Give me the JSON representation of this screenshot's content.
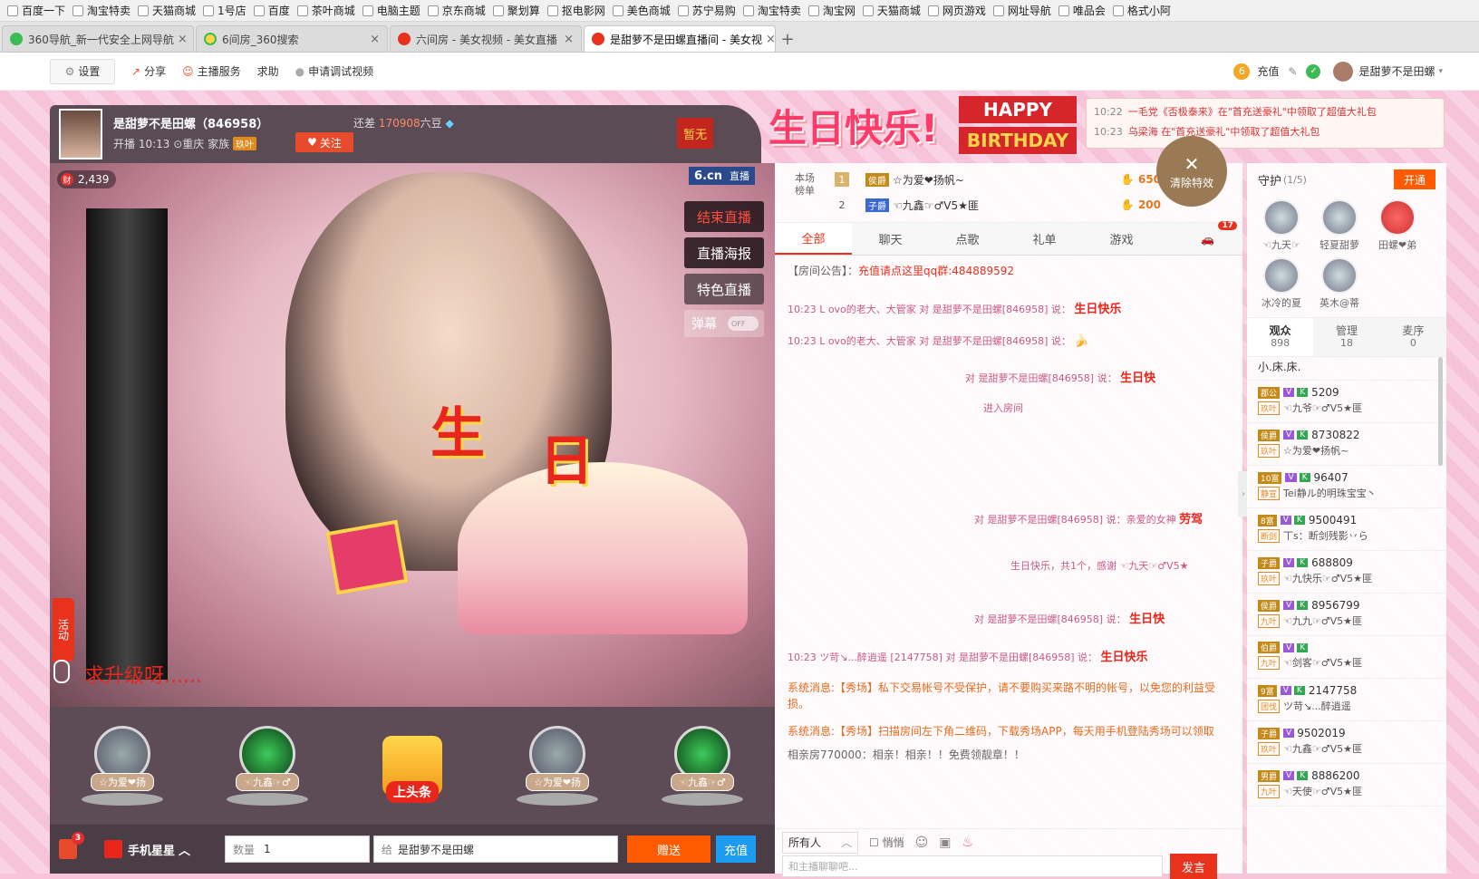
{
  "bookmarks": [
    "百度一下",
    "淘宝特卖",
    "天猫商城",
    "1号店",
    "百度",
    "茶叶商城",
    "电脑主题",
    "京东商城",
    "聚划算",
    "抠电影网",
    "美色商城",
    "苏宁易购",
    "淘宝特卖",
    "淘宝网",
    "天猫商城",
    "网页游戏",
    "网址导航",
    "唯品会",
    "格式小阿"
  ],
  "tabs": [
    {
      "label": "360导航_新一代安全上网导航",
      "close": "×"
    },
    {
      "label": "6间房_360搜索",
      "close": "×"
    },
    {
      "label": "六间房 - 美女视频 - 美女直播",
      "close": "×"
    },
    {
      "label": "是甜萝不是田螺直播间 - 美女视",
      "close": "×"
    }
  ],
  "tab_add": "+",
  "site_top": {
    "settings": "设置",
    "share": "分享",
    "host_service": "主播服务",
    "help": "求助",
    "apply_video": "申请调试视频",
    "recharge": "充值",
    "username": "是甜萝不是田螺"
  },
  "anchor": {
    "name": "是甜萝不是田螺（846958）",
    "need_prefix": "还差",
    "need_value": "170908",
    "need_unit": "六豆",
    "live_time": "开播 10:13",
    "city": "重庆",
    "family_label": "家族",
    "family_badge": "玖叶",
    "follow": "关注",
    "flag": "暂无"
  },
  "video": {
    "viewer_count": "2,439",
    "viewer_badge": "财",
    "logo": "6.cn",
    "logo_sub": "直播",
    "end_live": "结束直播",
    "live_poster": "直播海报",
    "special_live": "特色直播",
    "danmu": "弹幕",
    "danmu_switch": "OFF",
    "activity": "活动",
    "upgrade_text": "求升级呀......",
    "sheng": "生",
    "ri": "日"
  },
  "rank_items": [
    {
      "label": "☆为爱❤扬"
    },
    {
      "label": "☜九鑫☞♂"
    },
    {
      "label": "上头条"
    },
    {
      "label": "☆为爱❤扬"
    },
    {
      "label": "☜九鑫☞♂"
    }
  ],
  "gift_bar": {
    "badge": "3",
    "mobile_star": "手机星星",
    "qty_label": "数量",
    "qty_value": "1",
    "to_label": "给",
    "to_value": "是甜萝不是田螺",
    "send": "赠送",
    "charge": "充值"
  },
  "birthday": {
    "cn": "生日快乐!",
    "happy": "HAPPY",
    "birthday": "BIRTHDAY"
  },
  "notices": [
    {
      "time": "10:22",
      "text": "一毛党《否极泰来》在\"首充送豪礼\"中领取了超值大礼包"
    },
    {
      "time": "10:23",
      "text": "乌梁海 在\"首充送豪礼\"中领取了超值大礼包"
    }
  ],
  "clear_fx": "清除特效",
  "board": {
    "label": "本场榜单",
    "rows": [
      {
        "no": "1",
        "badge": "侯爵",
        "name": "☆为爱❤扬帆~",
        "score": "650"
      },
      {
        "no": "2",
        "badge": "子爵",
        "name": "☜九鑫☞♂V5★匪",
        "score": "200"
      }
    ]
  },
  "chat_tabs": [
    "全部",
    "聊天",
    "点歌",
    "礼单",
    "游戏"
  ],
  "car_badge": "17",
  "announcement": {
    "label": "【房间公告】：",
    "text": "充值请点这里qq群:484889592"
  },
  "messages": [
    {
      "text": "10:23 L ovo的老大、大管家 对 是甜萝不是田螺[846958] 说：",
      "em": "生日快乐"
    },
    {
      "text": "10:23 L ovo的老大、大管家 对 是甜萝不是田螺[846958] 说：",
      "em": "🍌"
    },
    {
      "text": "对 是甜萝不是田螺[846958] 说：",
      "em": "生日快"
    },
    {
      "text": "进入房间",
      "em": ""
    },
    {
      "text": "对 是甜萝不是田螺[846958] 说：亲爱的女神",
      "em": "劳驾"
    },
    {
      "text": "生日快乐，共1个，感谢 ☜九天☞♂V5★",
      "em": ""
    },
    {
      "text": "对 是甜萝不是田螺[846958] 说：",
      "em": "生日快"
    },
    {
      "text": "10:23 ツ苛↘...醉逍遥 [2147758] 对 是甜萝不是田螺[846958] 说：",
      "em": "生日快乐"
    }
  ],
  "sys_msgs": [
    "系统消息:【秀场】私下交易帐号不受保护，请不要购买来路不明的帐号，以免您的利益受损。",
    "系统消息:【秀场】扫描房间左下角二维码，下载秀场APP，每天用手机登陆秀场可以领取",
    "相亲房770000：相亲！相亲！！免费领靓章！！"
  ],
  "chat_footer": {
    "target": "所有人",
    "whisper": "悄悄",
    "placeholder": "和主播聊聊吧...",
    "post": "发言"
  },
  "guard": {
    "title": "守护",
    "count": "(1/5)",
    "open": "开通",
    "members": [
      "☜九天☞",
      "轻夏甜萝",
      "田螺❤弟",
      "冰冷的夏",
      "英木@蒂"
    ]
  },
  "user_tabs": [
    {
      "label": "观众",
      "count": "898"
    },
    {
      "label": "管理",
      "count": "18"
    },
    {
      "label": "麦序",
      "count": "0"
    }
  ],
  "first_user": "小.床.床.",
  "users": [
    {
      "lv": "郡公",
      "v": "V",
      "k": "K",
      "id": "5209",
      "fam": "玖叶",
      "name": "☜九爷☞♂V5★匪"
    },
    {
      "lv": "侯爵",
      "v": "V",
      "k": "K",
      "id": "8730822",
      "fam": "玖叶",
      "name": "☆为爱❤扬帆~"
    },
    {
      "lv": "10富",
      "v": "V",
      "k": "K",
      "id": "96407",
      "fam": "静宣",
      "name": "Tei静ル的明珠宝宝丶"
    },
    {
      "lv": "8富",
      "v": "V",
      "k": "K",
      "id": "9500491",
      "fam": "断剑",
      "name": "丅s：断剑残影丷ら"
    },
    {
      "lv": "子爵",
      "v": "V",
      "k": "K",
      "id": "688809",
      "fam": "玖叶",
      "name": "☜九快乐☞♂V5★匪"
    },
    {
      "lv": "侯爵",
      "v": "V",
      "k": "K",
      "id": "8956799",
      "fam": "九叶",
      "name": "☜九九☞♂V5★匪"
    },
    {
      "lv": "伯爵",
      "v": "V",
      "k": "K",
      "id": "",
      "fam": "九叶",
      "name": "☜剑客☞♂V5★匪"
    },
    {
      "lv": "9富",
      "v": "V",
      "k": "K",
      "id": "2147758",
      "fam": "团伐",
      "name": "ツ苛↘...醉逍遥"
    },
    {
      "lv": "子爵",
      "v": "V",
      "k": "",
      "id": "9502019",
      "fam": "玖叶",
      "name": "☜九鑫☞♂V5★匪"
    },
    {
      "lv": "男爵",
      "v": "V",
      "k": "K",
      "id": "8886200",
      "fam": "九叶",
      "name": "☜天使☞♂V5★匪"
    }
  ],
  "colors": {
    "accent": "#e8321c",
    "send": "#ff5a00",
    "charge": "#1d9bf0"
  }
}
